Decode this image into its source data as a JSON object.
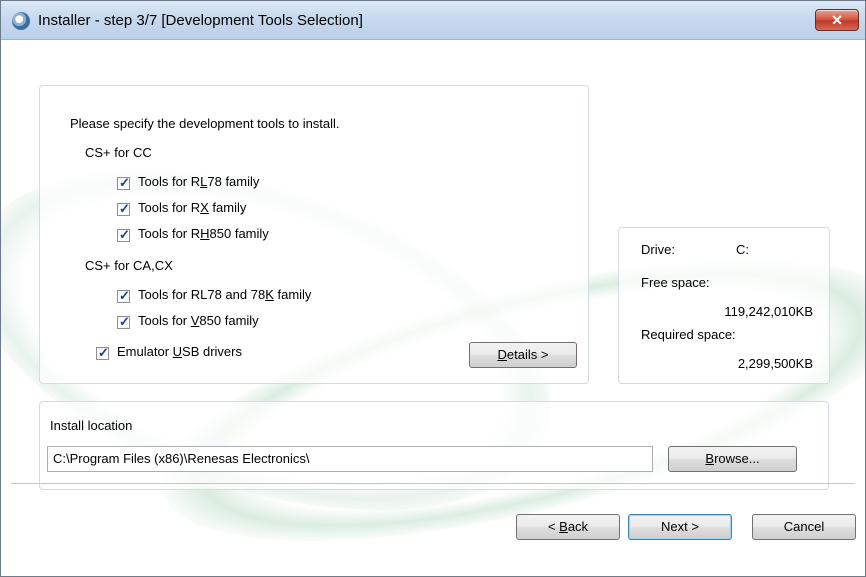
{
  "window": {
    "title": "Installer - step 3/7 [Development Tools Selection]",
    "close_label": "✕"
  },
  "tools": {
    "heading": "Please specify the development tools to install.",
    "group_cc": "CS+ for CC",
    "group_cacx": "CS+ for CA,CX",
    "items": [
      {
        "pre": "Tools for R",
        "key": "L",
        "post": "78 family",
        "checked": true
      },
      {
        "pre": "Tools for R",
        "key": "X",
        "post": " family",
        "checked": true
      },
      {
        "pre": "Tools for R",
        "key": "H",
        "post": "850 family",
        "checked": true
      },
      {
        "pre": "Tools for RL78 and 78",
        "key": "K",
        "post": " family",
        "checked": true
      },
      {
        "pre": "Tools for ",
        "key": "V",
        "post": "850 family",
        "checked": true
      },
      {
        "pre": "Emulator ",
        "key": "U",
        "post": "SB drivers",
        "checked": true
      }
    ],
    "details": {
      "pre": "",
      "key": "D",
      "post": "etails >"
    }
  },
  "space": {
    "drive_label": "Drive:",
    "drive_value": "C:",
    "free_label": "Free space:",
    "free_value": "119,242,010KB",
    "required_label": "Required space:",
    "required_value": "2,299,500KB"
  },
  "location": {
    "label": "Install location",
    "path": "C:\\Program Files (x86)\\Renesas Electronics\\",
    "browse": {
      "pre": "",
      "key": "B",
      "post": "rowse..."
    }
  },
  "footer": {
    "back": {
      "pre": "< ",
      "key": "B",
      "post": "ack"
    },
    "next": "Next >",
    "cancel": "Cancel"
  }
}
